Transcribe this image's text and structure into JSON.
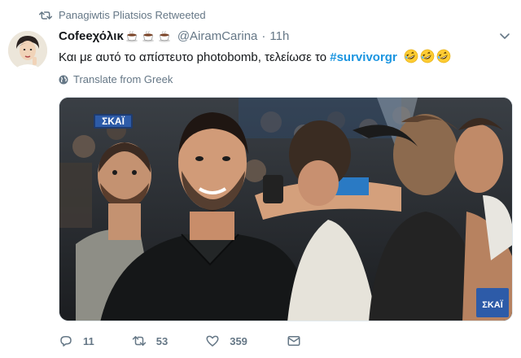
{
  "retweet": {
    "label": "Panagiwtis Pliatsios Retweeted",
    "icon": "retweet-icon"
  },
  "tweet": {
    "name": "Cofeeχόλικ",
    "name_emojis": [
      "coffee-cup-icon",
      "coffee-cup-icon",
      "coffee-cup-icon"
    ],
    "handle": "@AiramCarina",
    "separator": "·",
    "time": "11h",
    "text": "Και με αυτό το απίστευτο photobomb, τελείωσε το ",
    "hashtag": "#survivorgr",
    "trailing_emojis": [
      "rolling-laughing-emoji",
      "rolling-laughing-emoji",
      "rolling-laughing-emoji"
    ],
    "translate_label": "Translate from Greek"
  },
  "media": {
    "channel_logo": "ΣΚΑΪ",
    "channel_logo_corner": "ΣΚΑΪ"
  },
  "actions": {
    "replies": "11",
    "retweets": "53",
    "likes": "359"
  },
  "colors": {
    "link": "#1b95e0",
    "muted": "#657786",
    "text": "#14171a"
  }
}
